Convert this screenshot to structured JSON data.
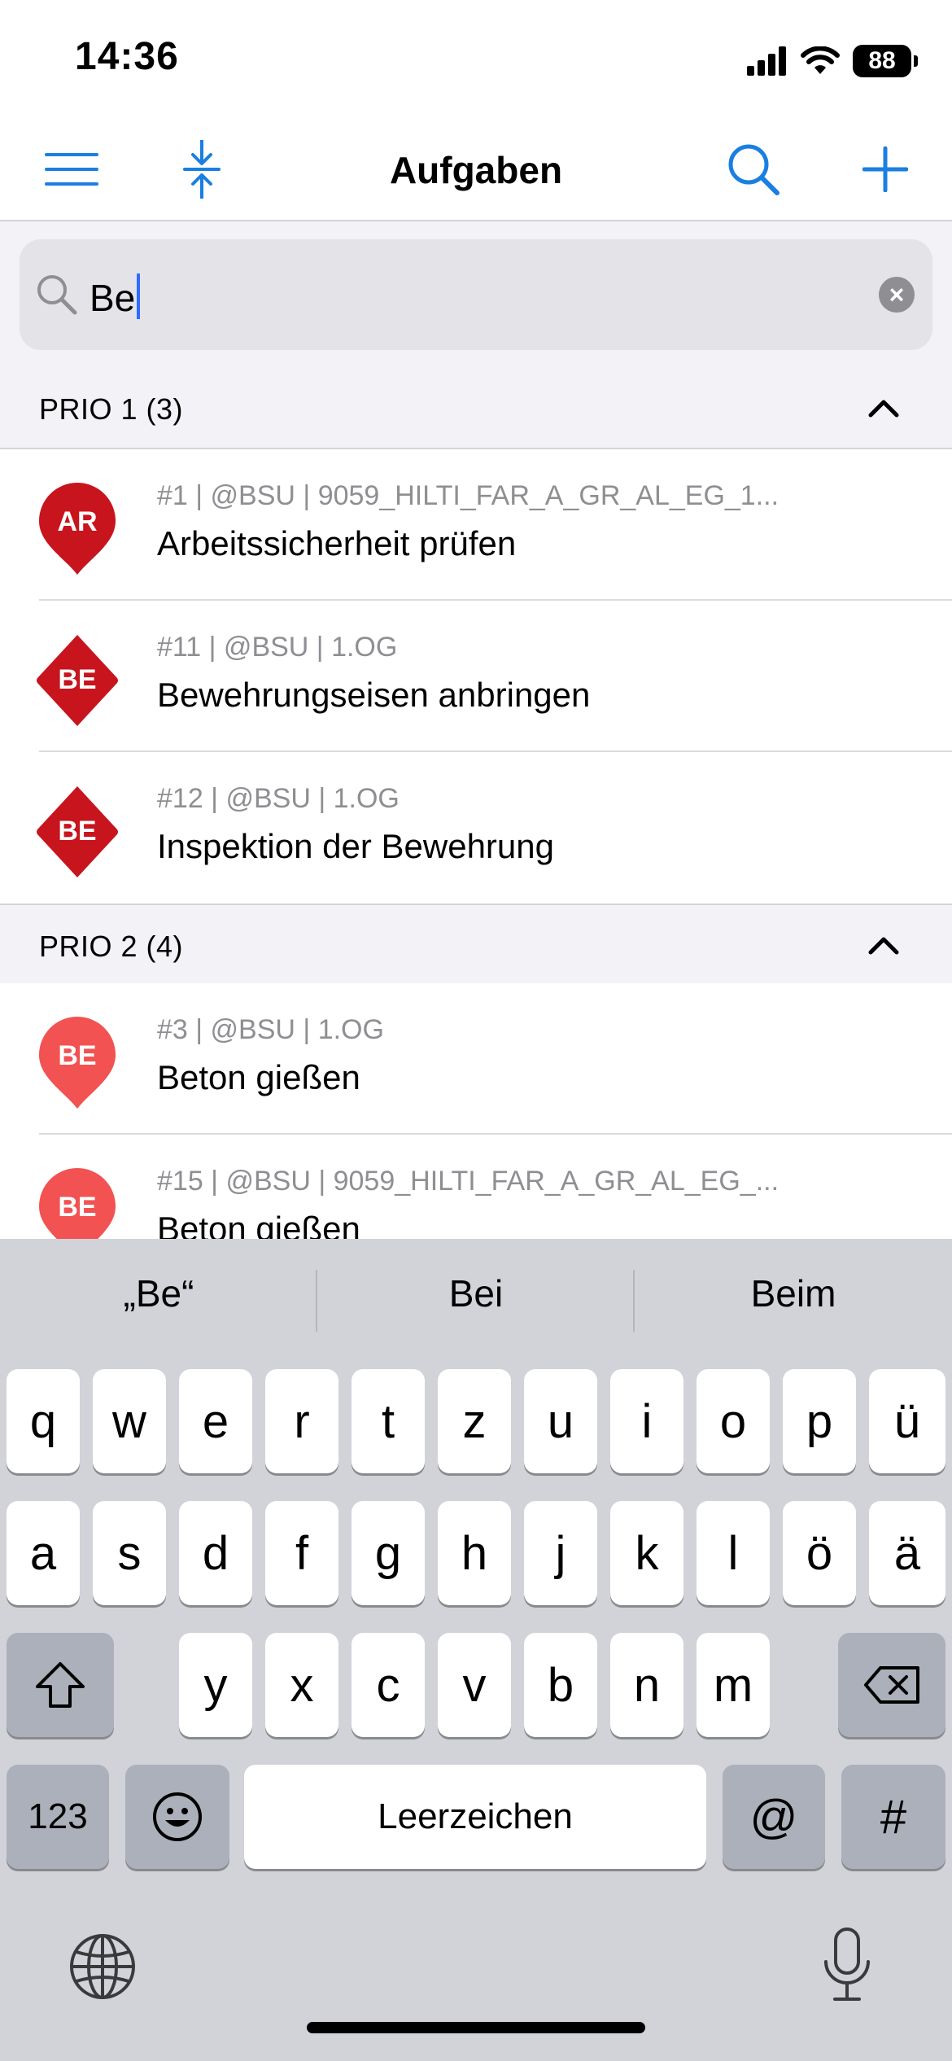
{
  "status_bar": {
    "time": "14:36",
    "battery": "88"
  },
  "nav": {
    "title": "Aufgaben",
    "menu_icon": "hamburger-icon",
    "collapse_icon": "collapse-vertical-icon",
    "search_icon": "search-icon",
    "add_icon": "plus-icon"
  },
  "search": {
    "value": "Be"
  },
  "sections": [
    {
      "title": "PRIO 1 (3)",
      "items": [
        {
          "badge": "AR",
          "shape": "pin",
          "meta": "#1 | @BSU | 9059_HILTI_FAR_A_GR_AL_EG_1...",
          "title": "Arbeitssicherheit prüfen"
        },
        {
          "badge": "BE",
          "shape": "diamond",
          "meta": "#11 | @BSU | 1.OG",
          "title": "Bewehrungseisen anbringen"
        },
        {
          "badge": "BE",
          "shape": "diamond",
          "meta": "#12 | @BSU | 1.OG",
          "title": "Inspektion der Bewehrung"
        }
      ]
    },
    {
      "title": "PRIO 2 (4)",
      "items": [
        {
          "badge": "BE",
          "shape": "pin",
          "meta": "#3 | @BSU | 1.OG",
          "title": "Beton gießen"
        },
        {
          "badge": "BE",
          "shape": "pin",
          "meta": "#15 | @BSU | 9059_HILTI_FAR_A_GR_AL_EG_...",
          "title": "Beton gießen"
        }
      ]
    }
  ],
  "colors": {
    "accent": "#1a7fe0",
    "prio1": "#c8141c",
    "prio2": "#f25252"
  },
  "keyboard": {
    "suggestions": [
      "„Be“",
      "Bei",
      "Beim"
    ],
    "row1": [
      "q",
      "w",
      "e",
      "r",
      "t",
      "z",
      "u",
      "i",
      "o",
      "p",
      "ü"
    ],
    "row2": [
      "a",
      "s",
      "d",
      "f",
      "g",
      "h",
      "j",
      "k",
      "l",
      "ö",
      "ä"
    ],
    "row3": [
      "y",
      "x",
      "c",
      "v",
      "b",
      "n",
      "m"
    ],
    "numbers": "123",
    "space": "Leerzeichen",
    "at": "@",
    "hash": "#"
  }
}
